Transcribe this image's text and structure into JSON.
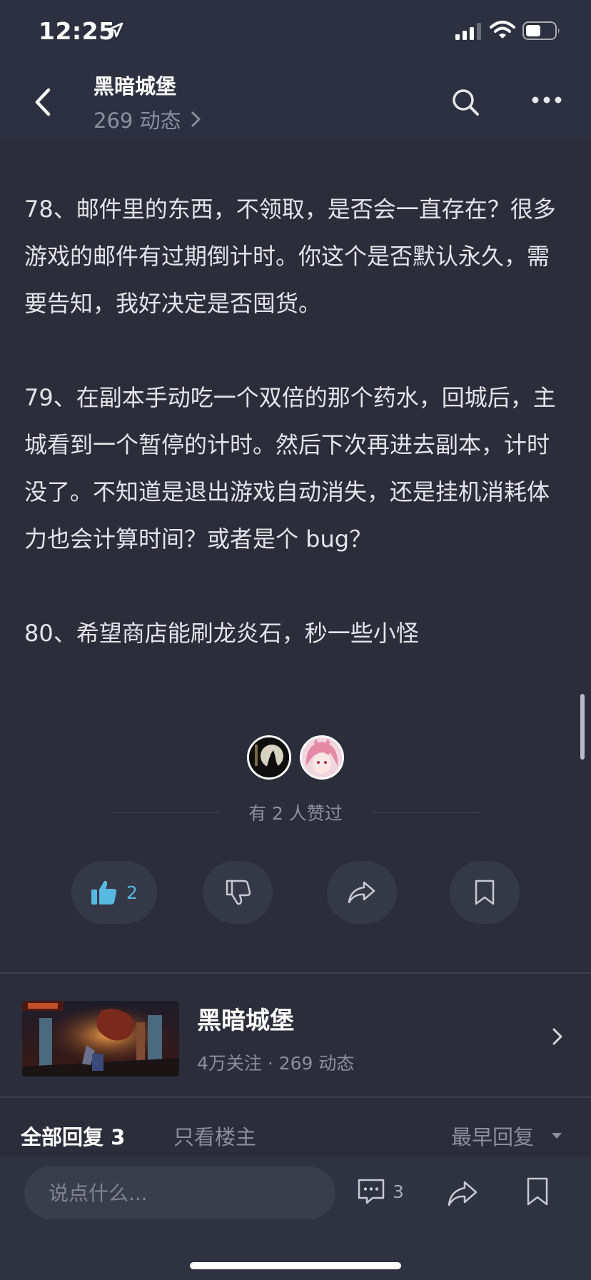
{
  "status_bar": {
    "time": "12:25"
  },
  "header": {
    "title": "黑暗城堡",
    "subtitle": "269 动态"
  },
  "article": {
    "paragraphs": [
      "78、邮件里的东西，不领取，是否会一直存在？很多游戏的邮件有过期倒计时。你这个是否默认永久，需要告知，我好决定是否囤货。",
      "79、在副本手动吃一个双倍的那个药水，回城后，主城看到一个暂停的计时。然后下次再进去副本，计时没了。不知道是退出游戏自动消失，还是挂机消耗体力也会计算时间？或者是个 bug？",
      "80、希望商店能刷龙炎石，秒一些小怪"
    ]
  },
  "likes": {
    "text": "有 2 人赞过",
    "count": "2"
  },
  "game_card": {
    "name": "黑暗城堡",
    "meta": "4万关注 · 269 动态"
  },
  "replies": {
    "tab_all": "全部回复 3",
    "tab_owner": "只看楼主",
    "sort": "最早回复"
  },
  "bottom_bar": {
    "input_placeholder": "说点什么...",
    "comment_count": "3"
  },
  "colors": {
    "background": "#2b2d3a",
    "header": "#2d3040",
    "accent_like": "#58b9e0"
  }
}
